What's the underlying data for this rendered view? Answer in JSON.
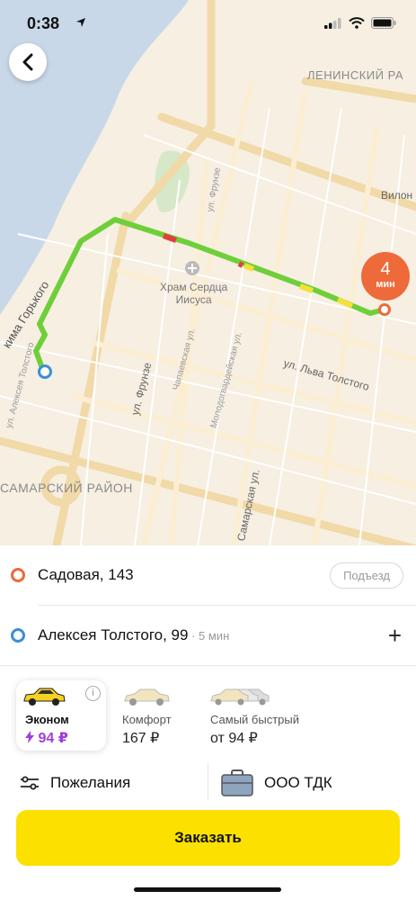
{
  "status": {
    "time": "0:38"
  },
  "map": {
    "district_top": "ЛЕНИНСКИЙ РА",
    "district_bottom": "САМАРСКИЙ РАЙОН",
    "poi": "Храм Сердца\nИисуса",
    "streets": {
      "frunze_top": "ул. Фрунзе",
      "frunze": "ул. Фрунзе",
      "vilon": "Вилон",
      "gorkogo": "кима Горького",
      "aleksey": "ул. Алексея Толстого",
      "chapaev": "Чапаевская ул.",
      "molodog": "Молодогвардейская ул.",
      "lva": "ул. Льва Толстого",
      "samarskaya": "Самарская ул."
    },
    "eta": {
      "number": "4",
      "unit": "мин"
    }
  },
  "route": {
    "from": {
      "address": "Садовая, 143",
      "entrance_label": "Подъезд"
    },
    "to": {
      "address": "Алексея Толстого, 99",
      "eta": " · 5 мин"
    }
  },
  "tariffs": [
    {
      "name": "Эконом",
      "price": "94 ₽",
      "selected": true
    },
    {
      "name": "Комфорт",
      "price": "167 ₽",
      "selected": false
    },
    {
      "name": "Самый быстрый",
      "price": "от 94 ₽",
      "selected": false
    }
  ],
  "options": {
    "wishes": "Пожелания",
    "payment": "ООО ТДК"
  },
  "order_button": "Заказать",
  "colors": {
    "accent_yellow": "#fce000",
    "route_green": "#6fcf3a",
    "origin_orange": "#ee6a3a",
    "dest_blue": "#3b8fd9",
    "promo_purple": "#a03ed8"
  }
}
